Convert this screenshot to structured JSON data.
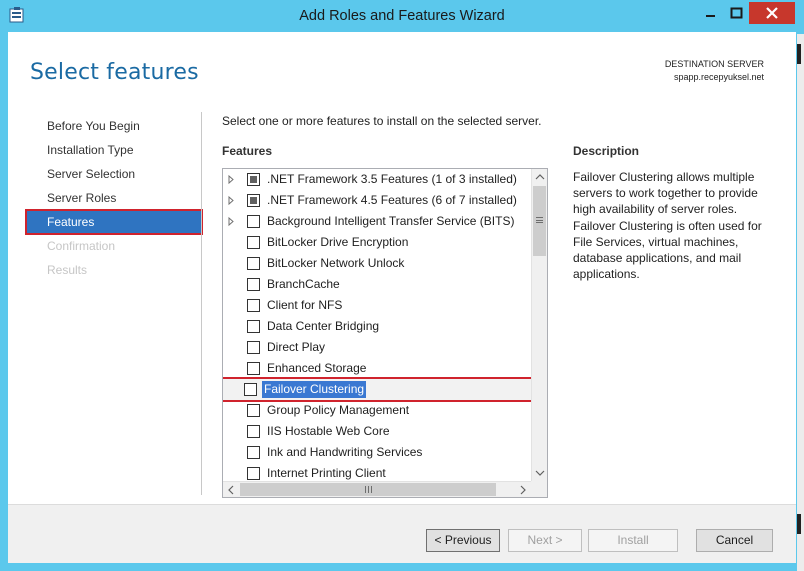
{
  "window": {
    "title": "Add Roles and Features Wizard",
    "accent_color": "#5bc8ec",
    "close_color": "#c7372c"
  },
  "page": {
    "title": "Select features",
    "destination_label": "DESTINATION SERVER",
    "destination_value": "spapp.recepyuksel.net"
  },
  "nav": {
    "items": [
      {
        "label": "Before You Begin",
        "state": "normal"
      },
      {
        "label": "Installation Type",
        "state": "normal"
      },
      {
        "label": "Server Selection",
        "state": "normal"
      },
      {
        "label": "Server Roles",
        "state": "normal"
      },
      {
        "label": "Features",
        "state": "active"
      },
      {
        "label": "Confirmation",
        "state": "disabled"
      },
      {
        "label": "Results",
        "state": "disabled"
      }
    ]
  },
  "main": {
    "intro": "Select one or more features to install on the selected server.",
    "features_heading": "Features",
    "features": [
      {
        "label": ".NET Framework 3.5 Features (1 of 3 installed)",
        "expandable": true,
        "check": "partial"
      },
      {
        "label": ".NET Framework 4.5 Features (6 of 7 installed)",
        "expandable": true,
        "check": "partial"
      },
      {
        "label": "Background Intelligent Transfer Service (BITS)",
        "expandable": true,
        "check": "none"
      },
      {
        "label": "BitLocker Drive Encryption",
        "expandable": false,
        "check": "none"
      },
      {
        "label": "BitLocker Network Unlock",
        "expandable": false,
        "check": "none"
      },
      {
        "label": "BranchCache",
        "expandable": false,
        "check": "none"
      },
      {
        "label": "Client for NFS",
        "expandable": false,
        "check": "none"
      },
      {
        "label": "Data Center Bridging",
        "expandable": false,
        "check": "none"
      },
      {
        "label": "Direct Play",
        "expandable": false,
        "check": "none"
      },
      {
        "label": "Enhanced Storage",
        "expandable": false,
        "check": "none"
      },
      {
        "label": "Failover Clustering",
        "expandable": false,
        "check": "none",
        "selected": true
      },
      {
        "label": "Group Policy Management",
        "expandable": false,
        "check": "none"
      },
      {
        "label": "IIS Hostable Web Core",
        "expandable": false,
        "check": "none"
      },
      {
        "label": "Ink and Handwriting Services",
        "expandable": false,
        "check": "none"
      },
      {
        "label": "Internet Printing Client",
        "expandable": false,
        "check": "none"
      }
    ]
  },
  "description": {
    "heading": "Description",
    "text": "Failover Clustering allows multiple servers to work together to provide high availability of server roles. Failover Clustering is often used for File Services, virtual machines, database applications, and mail applications."
  },
  "footer": {
    "previous_label": "< Previous",
    "next_label": "Next >",
    "install_label": "Install",
    "cancel_label": "Cancel"
  }
}
